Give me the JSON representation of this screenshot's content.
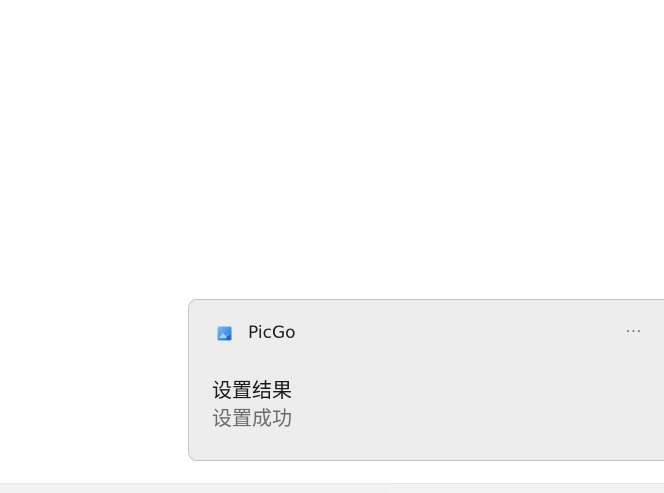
{
  "notification": {
    "app_name": "PicGo",
    "app_icon": "picgo-app-icon",
    "more_icon": "more-horizontal-icon",
    "more_label": "···",
    "title": "设置结果",
    "body": "设置成功"
  },
  "colors": {
    "toast_background": "#ededed",
    "toast_border": "#c6c6c6",
    "title_text": "#1a1a1a",
    "body_text": "#6b6b6b",
    "icon_blue": "#2f7fd8"
  }
}
